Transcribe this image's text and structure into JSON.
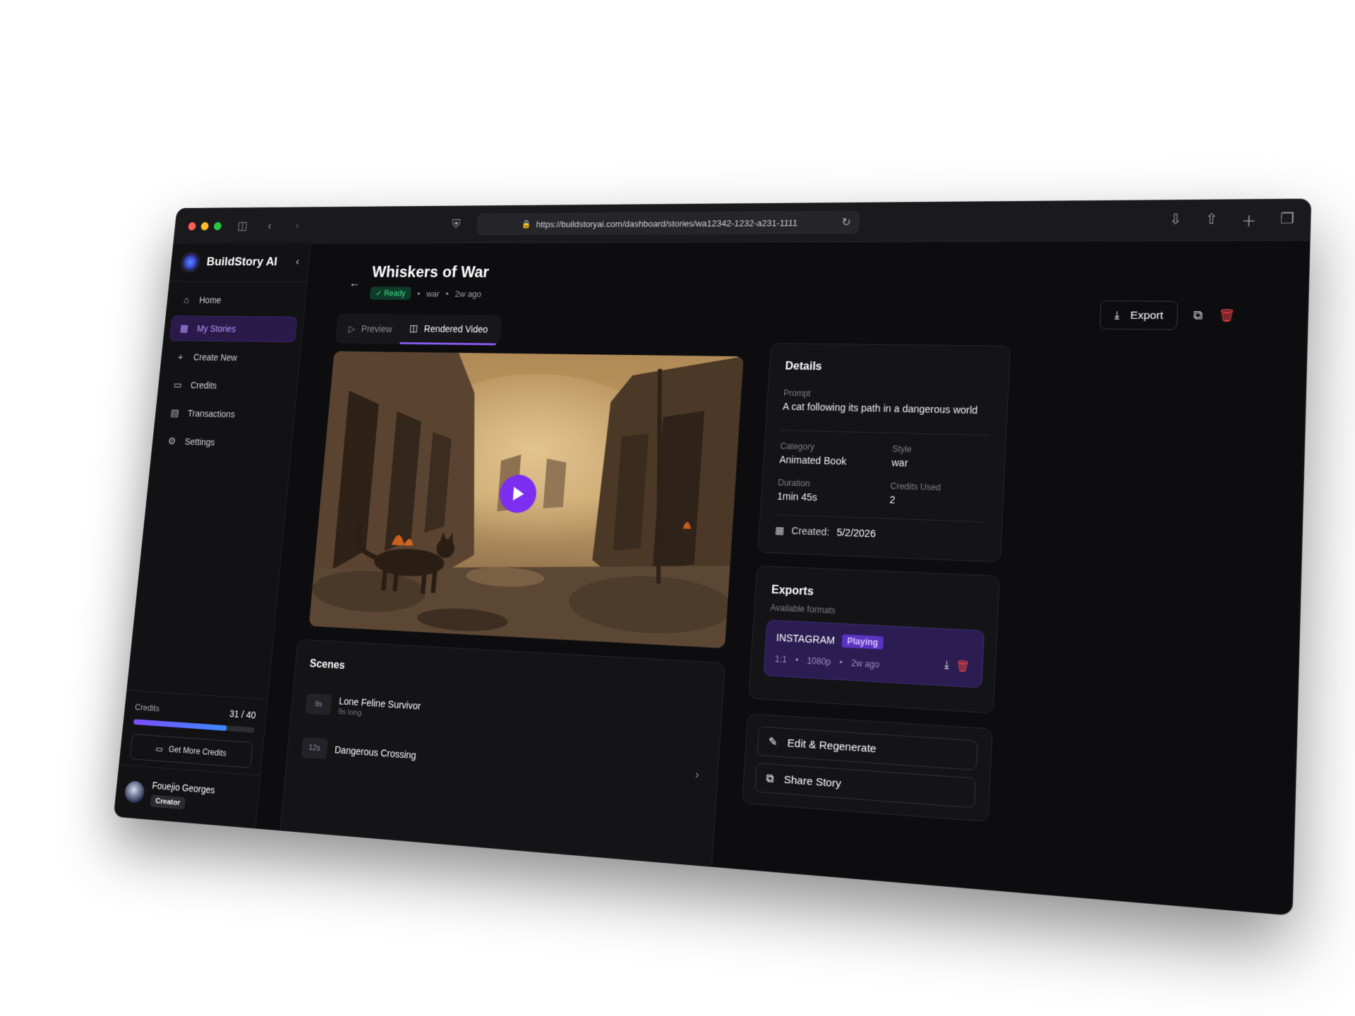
{
  "browser": {
    "url": "https://buildstoryai.com/dashboard/stories/wa12342-1232-a231-1111"
  },
  "sidebar": {
    "brand": "BuildStory AI",
    "items": [
      {
        "label": "Home",
        "icon": "home-icon"
      },
      {
        "label": "My Stories",
        "icon": "film-icon",
        "active": true
      },
      {
        "label": "Create New",
        "icon": "plus-icon"
      },
      {
        "label": "Credits",
        "icon": "card-icon"
      },
      {
        "label": "Transactions",
        "icon": "receipt-icon"
      },
      {
        "label": "Settings",
        "icon": "gear-icon"
      }
    ],
    "credits": {
      "label": "Credits",
      "value": "31 / 40",
      "used": 31,
      "total": 40,
      "button": "Get More Credits"
    },
    "user": {
      "name": "Fouejio Georges",
      "role": "Creator"
    }
  },
  "story": {
    "title": "Whiskers of War",
    "status": "Ready",
    "category_tag": "war",
    "age": "2w ago",
    "actions": {
      "export": "Export"
    },
    "tabs": [
      "Preview",
      "Rendered Video"
    ],
    "active_tab": 1
  },
  "scenes": {
    "heading": "Scenes",
    "items": [
      {
        "badge": "9s",
        "title": "Lone Feline Survivor",
        "sub": "9s long"
      },
      {
        "badge": "12s",
        "title": "Dangerous Crossing",
        "sub": ""
      }
    ]
  },
  "details": {
    "heading": "Details",
    "prompt_label": "Prompt",
    "prompt": "A cat following its path in a dangerous world",
    "category_label": "Category",
    "category": "Animated Book",
    "style_label": "Style",
    "style": "war",
    "duration_label": "Duration",
    "duration": "1min 45s",
    "credits_label": "Credits Used",
    "credits": "2",
    "created_label": "Created:",
    "created": "5/2/2026"
  },
  "exports": {
    "heading": "Exports",
    "sub": "Available formats",
    "item": {
      "name": "INSTAGRAM",
      "state": "Playing",
      "ratio": "1:1",
      "res": "1080p",
      "age": "2w ago"
    }
  },
  "quick_actions": {
    "edit": "Edit & Regenerate",
    "share": "Share Story"
  },
  "colors": {
    "accent": "#8b5cf6",
    "ready": "#3ddc84",
    "danger": "#ef4444"
  }
}
